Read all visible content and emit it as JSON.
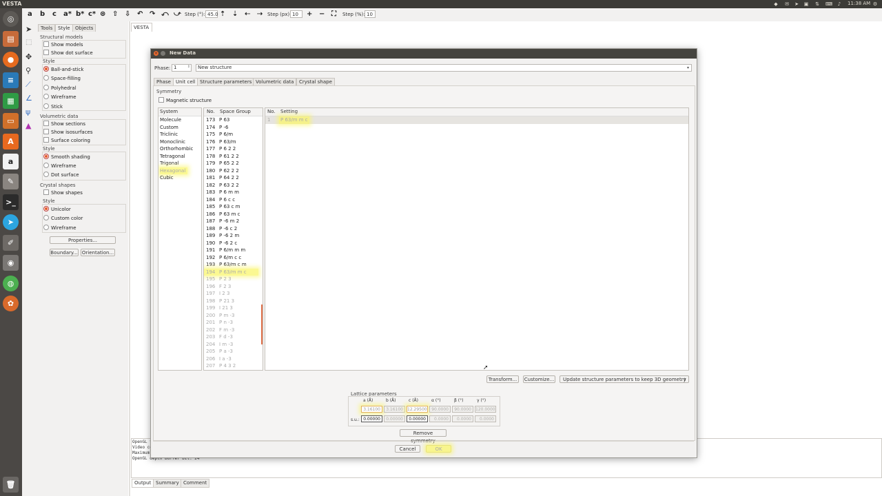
{
  "topbar": {
    "title": "VESTA",
    "time": "11:38 AM"
  },
  "launcher": {
    "apps": [
      "dash-icon",
      "files-icon",
      "firefox-icon",
      "writer-icon",
      "calc-icon",
      "impress-icon",
      "software-center-icon",
      "amazon-icon",
      "settings-icon",
      "terminal-icon",
      "telegram-icon",
      "text-editor-icon",
      "screenshot-icon",
      "chrome-icon",
      "app-icon",
      "trash-icon"
    ]
  },
  "toolbar": {
    "axes": [
      "a",
      "b",
      "c",
      "a*",
      "b*",
      "c*"
    ],
    "step_deg_label": "Step (°):",
    "step_deg_value": "45.0",
    "step_px_label": "Step (px):",
    "step_px_value": "10",
    "step_pct_label": "Step (%):",
    "step_pct_value": "10"
  },
  "sidepanel": {
    "tabs": [
      "Tools",
      "Style",
      "Objects"
    ],
    "structural_models": "Structural models",
    "show_models": "Show models",
    "show_dot_surface": "Show dot surface",
    "style_label": "Style",
    "styles": [
      "Ball-and-stick",
      "Space-filling",
      "Polyhedral",
      "Wireframe",
      "Stick"
    ],
    "volumetric_data": "Volumetric data",
    "show_sections": "Show sections",
    "show_isosurfaces": "Show isosurfaces",
    "surface_coloring": "Surface coloring",
    "vol_styles": [
      "Smooth shading",
      "Wireframe",
      "Dot surface"
    ],
    "crystal_shapes": "Crystal shapes",
    "show_shapes": "Show shapes",
    "crystal_styles": [
      "Unicolor",
      "Custom color",
      "Wireframe"
    ],
    "properties_btn": "Properties...",
    "boundary_btn": "Boundary...",
    "orientation_btn": "Orientation..."
  },
  "main": {
    "doc_tab": "VESTA",
    "console_lines": [
      "OpenGL v",
      "Video co",
      "Maximum",
      "OpenGL depth buffer bit: 24"
    ],
    "bottom_tabs": [
      "Output",
      "Summary",
      "Comment"
    ]
  },
  "dialog": {
    "title": "New Data",
    "phase_label": "Phase:",
    "phase_value": "1",
    "structure_title": "New structure",
    "tabs": [
      "Phase",
      "Unit cell",
      "Structure parameters",
      "Volumetric data",
      "Crystal shape"
    ],
    "symmetry_label": "Symmetry",
    "magnetic_label": "Magnetic structure",
    "system_header": "System",
    "systems": [
      "Molecule",
      "Custom",
      "Triclinic",
      "Monoclinic",
      "Orthorhombic",
      "Tetragonal",
      "Trigonal",
      "Hexagonal",
      "Cubic"
    ],
    "sg_header_no": "No.",
    "sg_header_name": "Space Group",
    "space_groups": [
      [
        "173",
        "P 63"
      ],
      [
        "174",
        "P -6"
      ],
      [
        "175",
        "P 6/m"
      ],
      [
        "176",
        "P 63/m"
      ],
      [
        "177",
        "P 6 2 2"
      ],
      [
        "178",
        "P 61 2 2"
      ],
      [
        "179",
        "P 65 2 2"
      ],
      [
        "180",
        "P 62 2 2"
      ],
      [
        "181",
        "P 64 2 2"
      ],
      [
        "182",
        "P 63 2 2"
      ],
      [
        "183",
        "P 6 m m"
      ],
      [
        "184",
        "P 6 c c"
      ],
      [
        "185",
        "P 63 c m"
      ],
      [
        "186",
        "P 63 m c"
      ],
      [
        "187",
        "P -6 m 2"
      ],
      [
        "188",
        "P -6 c 2"
      ],
      [
        "189",
        "P -6 2 m"
      ],
      [
        "190",
        "P -6 2 c"
      ],
      [
        "191",
        "P 6/m m m"
      ],
      [
        "192",
        "P 6/m c c"
      ],
      [
        "193",
        "P 63/m c m"
      ],
      [
        "194",
        "P 63/m m c"
      ],
      [
        "195",
        "P 2 3"
      ],
      [
        "196",
        "F 2 3"
      ],
      [
        "197",
        "I 2 3"
      ],
      [
        "198",
        "P 21 3"
      ],
      [
        "199",
        "I 21 3"
      ],
      [
        "200",
        "P m -3"
      ],
      [
        "201",
        "P n -3"
      ],
      [
        "202",
        "F m -3"
      ],
      [
        "203",
        "F d -3"
      ],
      [
        "204",
        "I m -3"
      ],
      [
        "205",
        "P a -3"
      ],
      [
        "206",
        "I a -3"
      ],
      [
        "207",
        "P 4 3 2"
      ]
    ],
    "setting_header_no": "No.",
    "setting_header_name": "Setting",
    "setting_row": [
      "1",
      "P 63/m m c"
    ],
    "transform_btn": "Transform...",
    "customize_btn": "Customize...",
    "update_combo": "Update structure parameters to keep 3D geometry",
    "lattice_label": "Lattice parameters",
    "lattice_headers": [
      "a (Å)",
      "b (Å)",
      "c (Å)",
      "α (°)",
      "β (°)",
      "γ (°)"
    ],
    "lattice_values": [
      "3.16100",
      "3.16100",
      "12.29500",
      "90.0000",
      "90.0000",
      "120.0000"
    ],
    "su_label": "s.u.:",
    "su_values": [
      "0.00000",
      "0.00000",
      "0.00000",
      "0.0000",
      "0.0000",
      "0.0000"
    ],
    "remove_symmetry_btn": "Remove symmetry",
    "cancel_btn": "Cancel",
    "ok_btn": "OK"
  }
}
